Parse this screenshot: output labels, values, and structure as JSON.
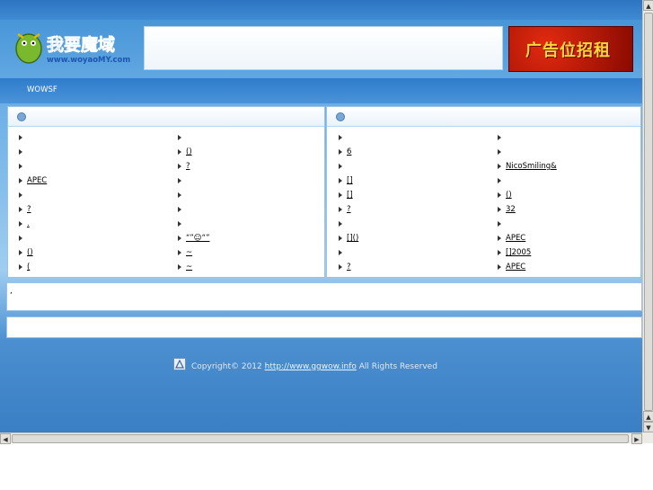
{
  "topbar": {
    "title": ""
  },
  "header": {
    "logo_text": "我要魔域",
    "logo_url": "www.woyaoMY.com",
    "nav": [
      "",
      ""
    ],
    "description": "",
    "ad_text": "广告位招租"
  },
  "marquee": {
    "text": "WOWSF"
  },
  "panels": {
    "left": {
      "title": "",
      "col1": [
        "",
        "",
        "",
        "APEC",
        "",
        "?",
        ".",
        "",
        "()",
        "("
      ],
      "col2": [
        "",
        "()",
        "?",
        "",
        "",
        "",
        "",
        "“”☺“”",
        "~",
        "~"
      ]
    },
    "right": {
      "title": "",
      "col1": [
        "",
        "6",
        "",
        "[]",
        "[]",
        "?",
        "",
        "[]()",
        "",
        "?"
      ],
      "col2": [
        "",
        "",
        "NicoSmiling&",
        "",
        "()",
        "32",
        "",
        "APEC",
        "[]2005",
        "APEC"
      ]
    }
  },
  "description_bar": {
    "text": ","
  },
  "links_bar": {
    "label": ""
  },
  "footer": {
    "copyright": "Copyright© 2012",
    "url": "http://www.ggwow.info",
    "rights": "All Rights Reserved"
  },
  "colors": {
    "accent": "#3f8fd4",
    "ad_red": "#d8240e",
    "ad_gold": "#ffd83a"
  }
}
